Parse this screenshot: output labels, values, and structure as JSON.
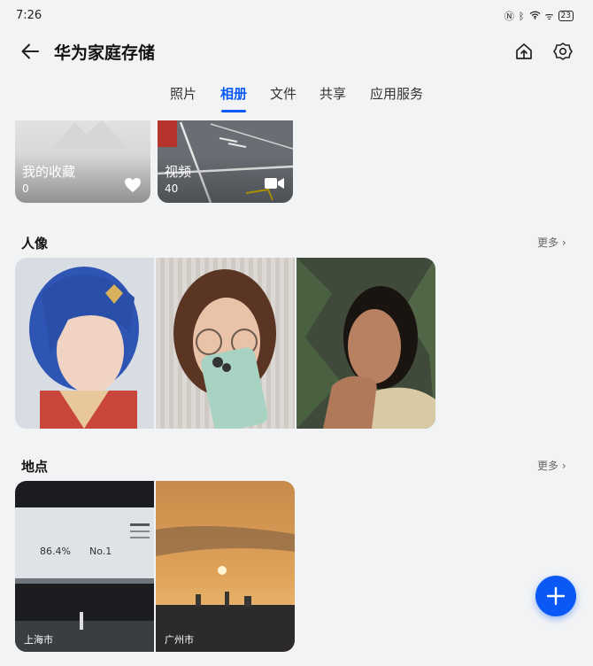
{
  "status": {
    "time": "7:26",
    "signal": "ᯤ",
    "battery": "23"
  },
  "app_bar": {
    "title": "华为家庭存储"
  },
  "tabs": [
    {
      "label": "照片"
    },
    {
      "label": "相册"
    },
    {
      "label": "文件"
    },
    {
      "label": "共享"
    },
    {
      "label": "应用服务"
    }
  ],
  "albums": [
    {
      "name": "我的收藏",
      "count": "0",
      "icon": "heart-icon"
    },
    {
      "name": "视频",
      "count": "40",
      "icon": "video-camera-icon"
    }
  ],
  "portraits": {
    "title": "人像",
    "more_label": "更多"
  },
  "places": {
    "title": "地点",
    "more_label": "更多",
    "items": [
      {
        "label": "上海市",
        "screen_percent": "86.4%",
        "screen_rank": "No.1"
      },
      {
        "label": "广州市"
      }
    ]
  }
}
